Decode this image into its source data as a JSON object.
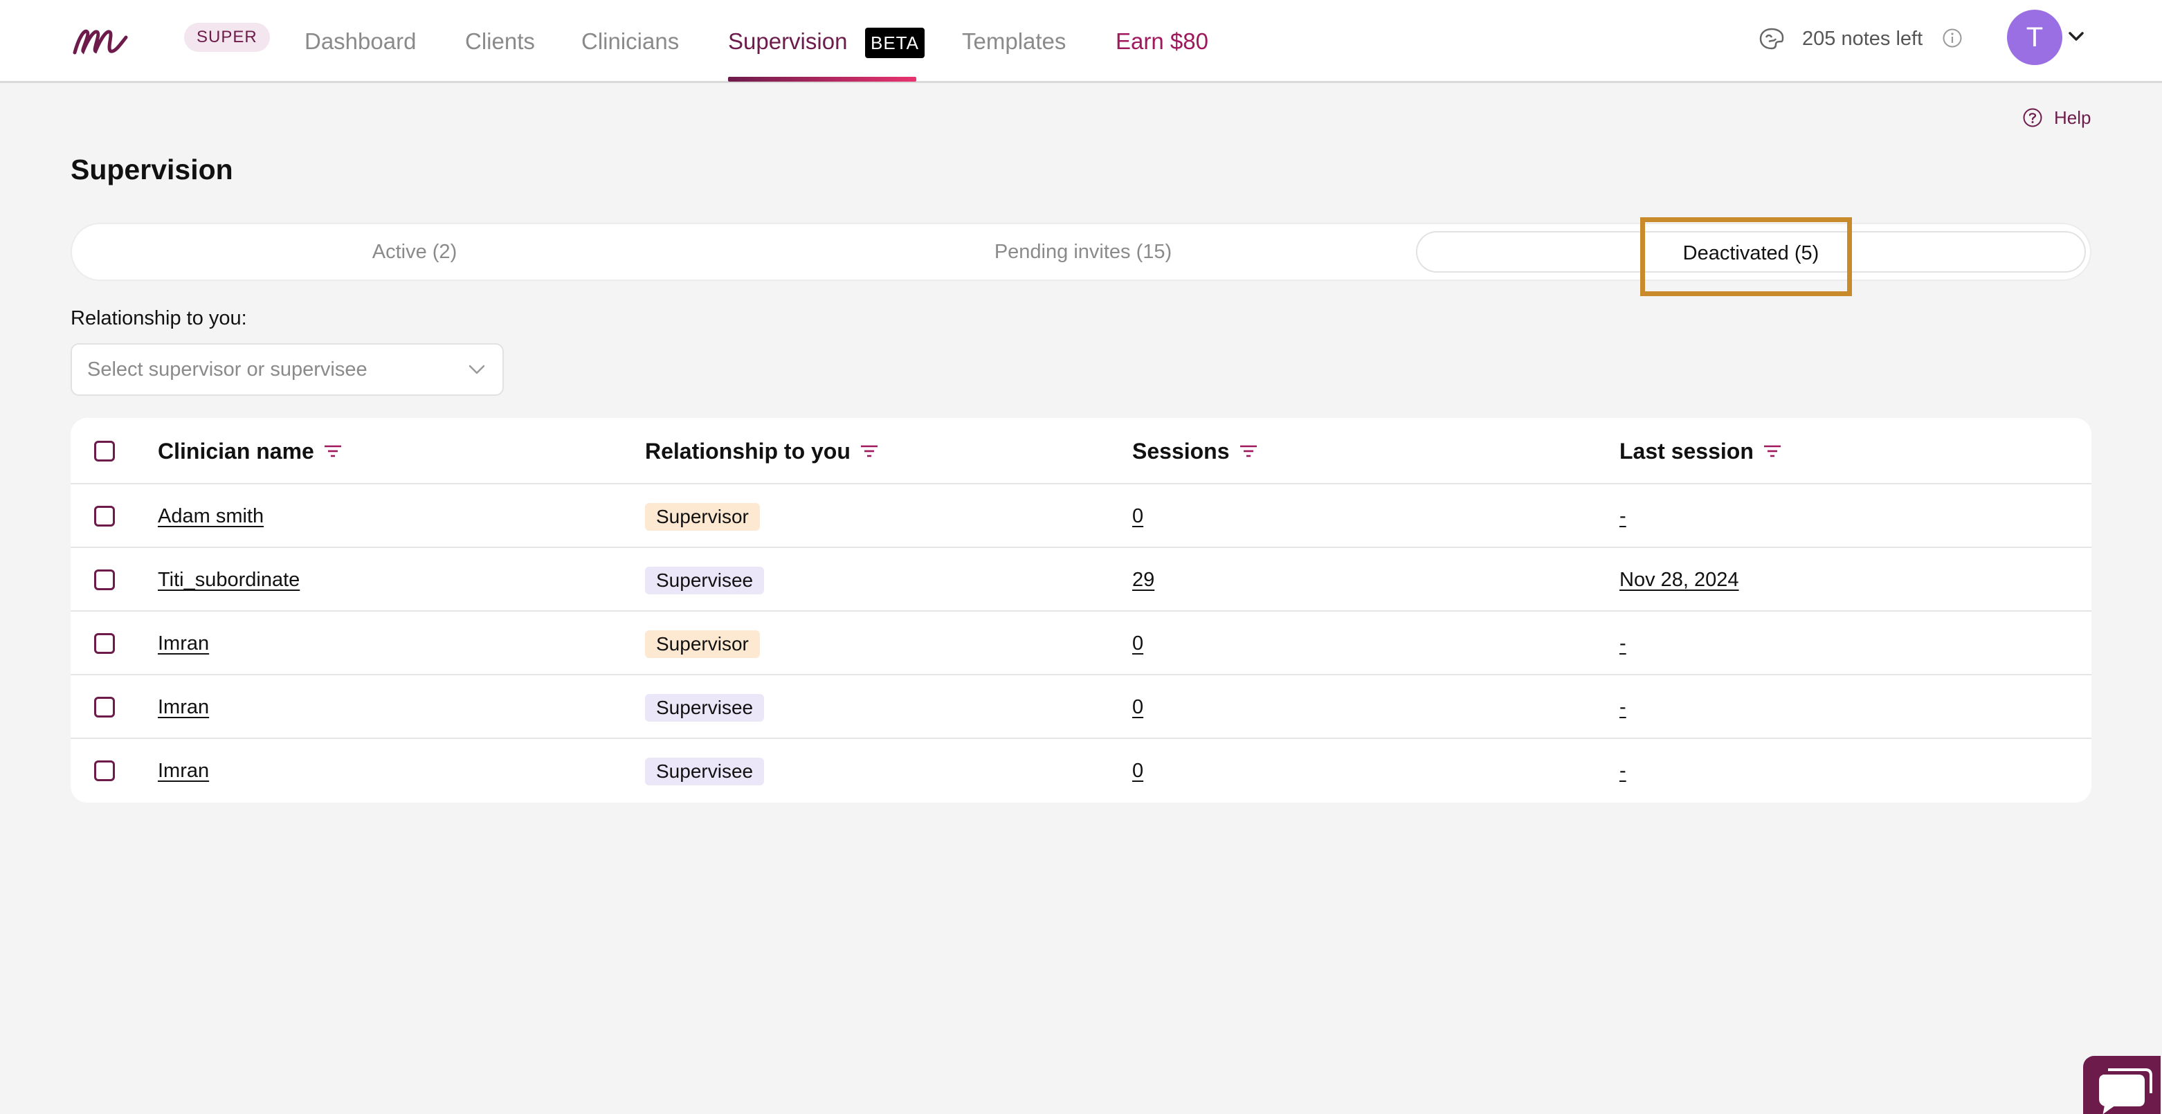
{
  "nav": {
    "logo_letter": "m",
    "super_badge": "SUPER",
    "items": [
      {
        "label": "Dashboard"
      },
      {
        "label": "Clients"
      },
      {
        "label": "Clinicians"
      },
      {
        "label": "Supervision"
      },
      {
        "label": "Templates"
      },
      {
        "label": "Earn $80"
      }
    ],
    "beta_badge": "BETA",
    "notes_left": "205 notes left",
    "avatar_initial": "T"
  },
  "help": {
    "label": "Help"
  },
  "page": {
    "title": "Supervision"
  },
  "tabs": [
    {
      "label": "Active (2)"
    },
    {
      "label": "Pending invites (15)"
    },
    {
      "label": "Deactivated (5)"
    }
  ],
  "filter": {
    "label": "Relationship to you:",
    "placeholder": "Select supervisor or supervisee"
  },
  "table": {
    "columns": [
      "Clinician name",
      "Relationship to you",
      "Sessions",
      "Last session"
    ],
    "rows": [
      {
        "name": "Adam smith",
        "relationship": "Supervisor",
        "sessions": "0",
        "last_session": "-"
      },
      {
        "name": "Titi_subordinate",
        "relationship": "Supervisee",
        "sessions": "29",
        "last_session": "Nov 28, 2024"
      },
      {
        "name": "Imran",
        "relationship": "Supervisor",
        "sessions": "0",
        "last_session": "-"
      },
      {
        "name": "Imran",
        "relationship": "Supervisee",
        "sessions": "0",
        "last_session": "-"
      },
      {
        "name": "Imran",
        "relationship": "Supervisee",
        "sessions": "0",
        "last_session": "-"
      }
    ]
  },
  "colors": {
    "brand": "#6d1b4b",
    "accent": "#e8336f",
    "highlight": "#c98a2c",
    "supervisor_badge": "#fde8d2",
    "supervisee_badge": "#ece7f8",
    "avatar": "#9b6fe4"
  },
  "icons": [
    "logo-icon",
    "notes-icon",
    "info-icon",
    "chevron-down-icon",
    "help-icon",
    "sort-icon",
    "chat-icon"
  ]
}
